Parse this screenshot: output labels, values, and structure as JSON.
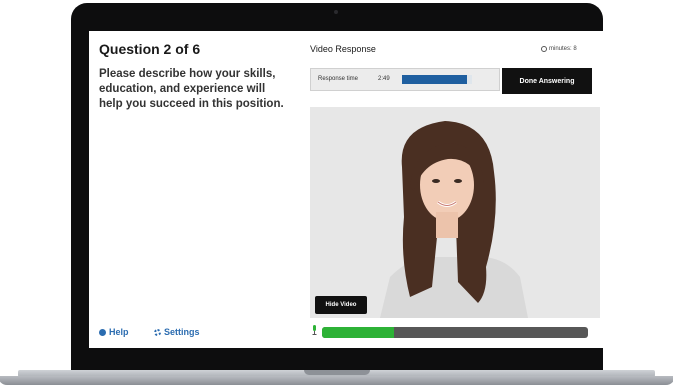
{
  "question": {
    "title": "Question 2 of 6",
    "text": "Please describe how your skills, education, and experience will help you succeed in this position."
  },
  "footer": {
    "help_label": "Help",
    "settings_label": "Settings"
  },
  "video_panel": {
    "title": "Video Response",
    "minutes_label": "minutes: 8",
    "response_time_label": "Response time",
    "response_time_value": "2:49",
    "response_progress_fraction": 0.93,
    "done_label": "Done Answering",
    "hide_video_label": "Hide Video",
    "audio_level_fraction": 0.27
  },
  "colors": {
    "link_blue": "#2b6cb0",
    "progress_blue": "#1f5fa0",
    "audio_green": "#2db236"
  }
}
